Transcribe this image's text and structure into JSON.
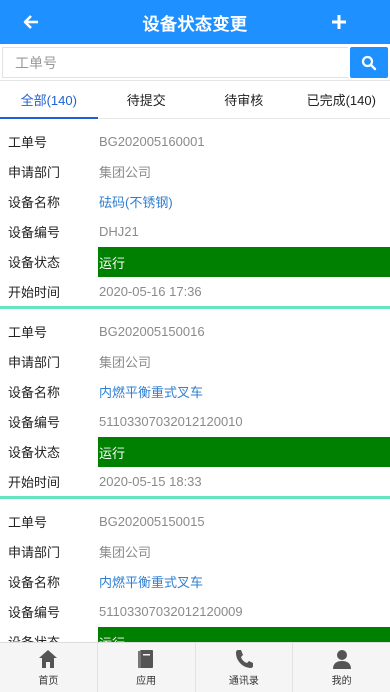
{
  "header": {
    "title": "设备状态变更",
    "back_icon": "arrow-left-icon",
    "add_icon": "plus-icon"
  },
  "search": {
    "placeholder": "工单号",
    "value": "",
    "icon": "search-icon"
  },
  "tabs": [
    {
      "label": "全部(140)",
      "active": true
    },
    {
      "label": "待提交",
      "active": false
    },
    {
      "label": "待审核",
      "active": false
    },
    {
      "label": "已完成(140)",
      "active": false
    }
  ],
  "labels": {
    "order_no": "工单号",
    "dept": "申请部门",
    "device_name": "设备名称",
    "device_no": "设备编号",
    "status": "设备状态",
    "start_time": "开始时间"
  },
  "records": [
    {
      "order_no": "BG202005160001",
      "dept": "集团公司",
      "device_name": "砝码(不锈钢)",
      "device_no": "DHJ21",
      "status": "运行",
      "start_time": "2020-05-16 17:36"
    },
    {
      "order_no": "BG202005150016",
      "dept": "集团公司",
      "device_name": "内燃平衡重式叉车",
      "device_no": "51103307032012120010",
      "status": "运行",
      "start_time": "2020-05-15 18:33"
    },
    {
      "order_no": "BG202005150015",
      "dept": "集团公司",
      "device_name": "内燃平衡重式叉车",
      "device_no": "51103307032012120009",
      "status": "运行",
      "start_time": ""
    }
  ],
  "bottom_nav": [
    {
      "label": "首页",
      "icon": "home-icon"
    },
    {
      "label": "应用",
      "icon": "book-icon"
    },
    {
      "label": "通讯录",
      "icon": "phone-icon"
    },
    {
      "label": "我的",
      "icon": "user-icon"
    }
  ],
  "colors": {
    "primary": "#1e90ff",
    "status_running": "#008000",
    "divider": "#66e5c2",
    "link": "#2f7fd1"
  }
}
